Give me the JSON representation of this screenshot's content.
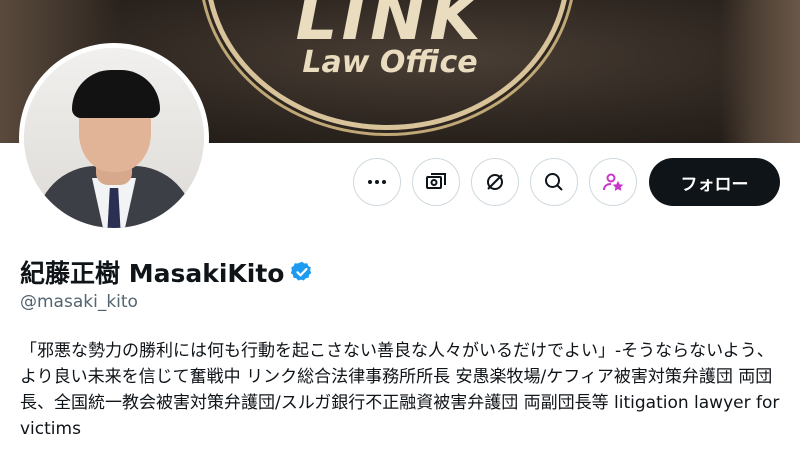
{
  "banner": {
    "brand_text": "LINK",
    "sub_text": "Law Office"
  },
  "profile": {
    "display_name": "紀藤正樹 MasakiKito",
    "handle": "@masaki_kito",
    "verified": true,
    "bio": "「邪悪な勢力の勝利には何も行動を起こさない善良な人々がいるだけでよい」-そうならないよう、より良い未来を信じて奮戦中 リンク総合法律事務所所長 安愚楽牧場/ケフィア被害対策弁護団 両団長、全国統一教会被害対策弁護団/スルガ銀行不正融資被害弁護団 両副団長等 litigation lawyer for victims"
  },
  "actions": {
    "more_icon": "more-icon",
    "subscribe_icon": "money-icon",
    "grok_icon": "grok-icon",
    "search_icon": "search-icon",
    "subscribe_star_icon": "person-star-icon",
    "follow_label": "フォロー"
  },
  "colors": {
    "verified_blue": "#1d9bf0",
    "subscribe_purple": "#c936cc",
    "follow_bg": "#0f1419"
  }
}
